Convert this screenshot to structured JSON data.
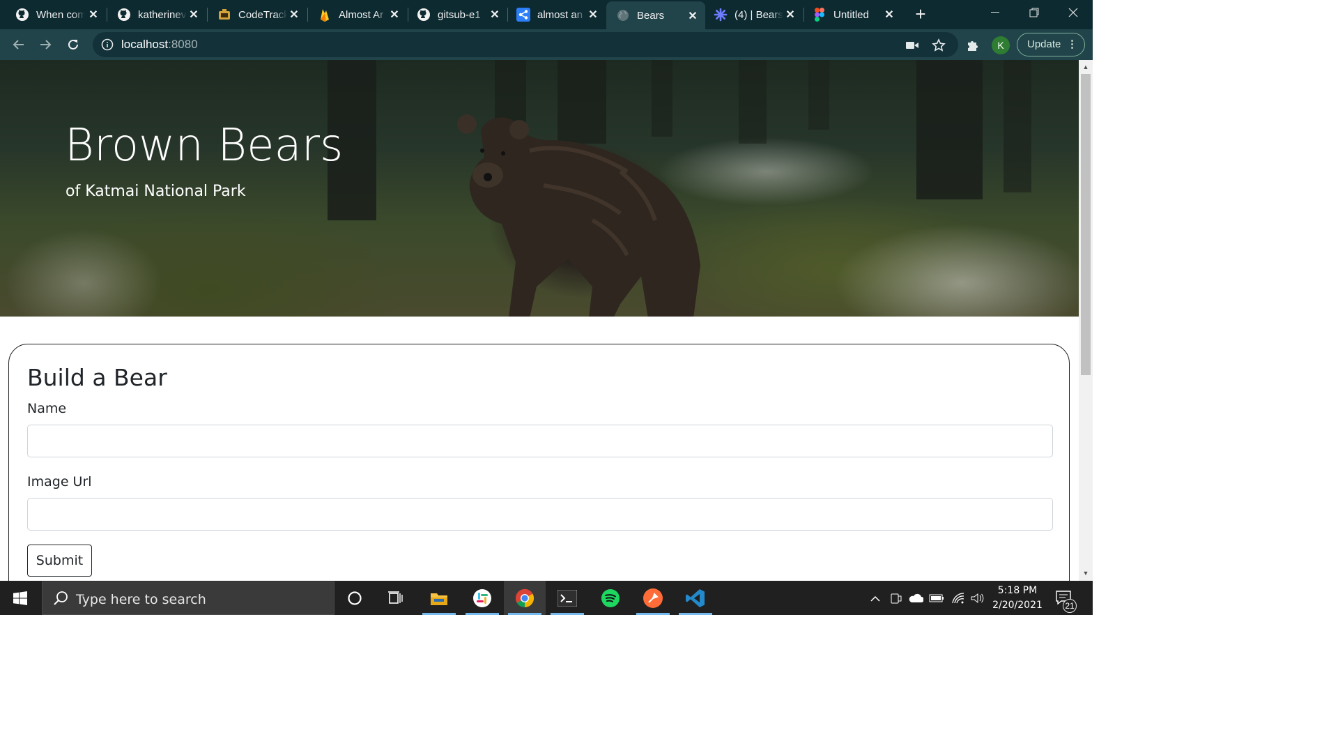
{
  "browser": {
    "tabs": [
      {
        "title": "When com",
        "icon": "github-icon"
      },
      {
        "title": "katherinev",
        "icon": "github-icon"
      },
      {
        "title": "CodeTrack",
        "icon": "codetrack-icon"
      },
      {
        "title": "Almost Ar",
        "icon": "firebase-icon"
      },
      {
        "title": "gitsub-e1",
        "icon": "github-icon"
      },
      {
        "title": "almost an",
        "icon": "share-icon"
      },
      {
        "title": "Bears",
        "icon": "globe-icon"
      },
      {
        "title": "(4) | Bears",
        "icon": "snowflake-icon"
      },
      {
        "title": "Untitled",
        "icon": "figma-icon"
      }
    ],
    "active_tab_index": 6,
    "address": {
      "host": "localhost",
      "port": ":8080"
    },
    "profile_initial": "K",
    "update_label": "Update",
    "update_menu_glyph": "⋮",
    "accent_color": "#21434a"
  },
  "page": {
    "hero": {
      "title": "Brown Bears",
      "subtitle": "of Katmai National Park"
    },
    "form": {
      "title": "Build a Bear",
      "name_label": "Name",
      "name_value": "",
      "image_label": "Image Url",
      "image_value": "",
      "submit_label": "Submit"
    }
  },
  "taskbar": {
    "search_placeholder": "Type here to search",
    "apps": [
      "cortana-icon",
      "task-view-icon",
      "file-explorer-icon",
      "slack-icon",
      "chrome-icon",
      "terminal-icon",
      "spotify-icon",
      "postman-icon",
      "vscode-icon"
    ],
    "time": "5:18 PM",
    "date": "2/20/2021",
    "notification_count": "21"
  }
}
